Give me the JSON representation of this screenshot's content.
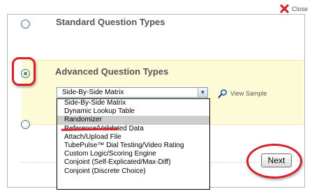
{
  "header": {
    "close_label": "Close",
    "close_icon": "close-x-icon"
  },
  "options": {
    "standard_label": "Standard Question Types",
    "advanced_label": "Advanced Question Types",
    "selected": "advanced"
  },
  "select": {
    "value": "Side-By-Side Matrix",
    "view_sample_label": "View Sample",
    "items": [
      "Side-By-Side Matrix",
      "Dynamic Lookup Table",
      "Randomizer",
      "Reference/Validated Data",
      "Attach/Upload File",
      "TubePulse™ Dial Testing/Video Rating",
      "Custom Logic/Scoring Engine",
      "Conjoint (Self-Explicated/Max-Diff)",
      "Conjoint (Discrete Choice)"
    ],
    "highlighted_item": "Randomizer"
  },
  "footer": {
    "next_label": "Next"
  },
  "colors": {
    "highlight_panel": "#fdfbd6",
    "annotation_red": "#d9202a",
    "selected_item": "#cdcdcd"
  }
}
